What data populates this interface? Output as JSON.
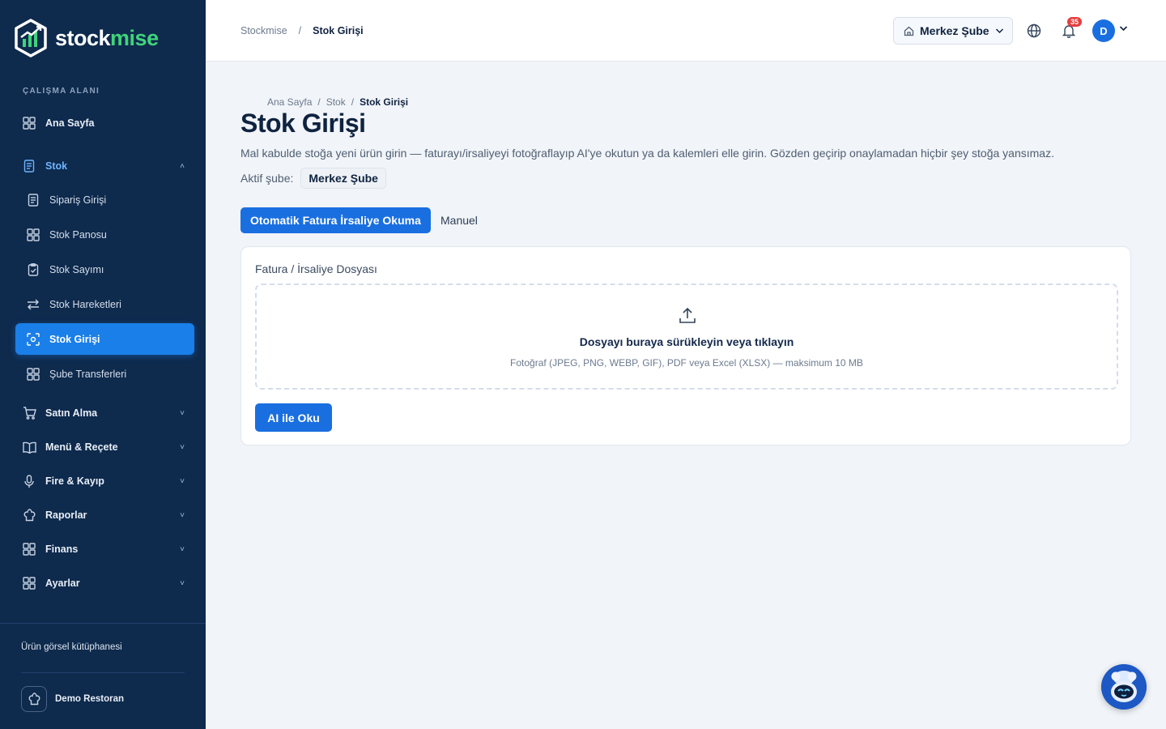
{
  "brand": {
    "part1": "stock",
    "part2": "mise"
  },
  "sidebar": {
    "section_title": "ÇALIŞMA ALANI",
    "items": [
      {
        "label": "Ana Sayfa"
      },
      {
        "label": "Stok"
      },
      {
        "label": "Sipariş Girişi"
      },
      {
        "label": "Stok Panosu"
      },
      {
        "label": "Stok Sayımı"
      },
      {
        "label": "Stok Hareketleri"
      },
      {
        "label": "Stok Girişi"
      },
      {
        "label": "Şube Transferleri"
      },
      {
        "label": "Satın Alma"
      },
      {
        "label": "Menü & Reçete"
      },
      {
        "label": "Fire & Kayıp"
      },
      {
        "label": "Raporlar"
      },
      {
        "label": "Finans"
      },
      {
        "label": "Ayarlar"
      }
    ],
    "library_link": "Ürün görsel kütüphanesi",
    "org_name": "Demo Restoran"
  },
  "topbar": {
    "crumb_root": "Stockmise",
    "crumb_sep": "/",
    "crumb_current": "Stok Girişi",
    "branch": "Merkez Şube",
    "notification_count": "35",
    "avatar_initial": "D"
  },
  "page": {
    "breadcrumb": [
      "Ana Sayfa",
      "/",
      "Stok",
      "/",
      "Stok Girişi"
    ],
    "title": "Stok Girişi",
    "description": "Mal kabulde stoğa yeni ürün girin — faturayı/irsaliyeyi fotoğraflayıp AI'ye okutun ya da kalemleri elle girin. Gözden geçirip onaylamadan hiçbir şey stoğa yansımaz.",
    "active_branch_label": "Aktif şube:",
    "active_branch": "Merkez Şube",
    "tabs": {
      "auto": "Otomatik Fatura İrsaliye Okuma",
      "manual": "Manuel"
    }
  },
  "upload": {
    "label": "Fatura / İrsaliye Dosyası",
    "drop_title": "Dosyayı buraya sürükleyin veya tıklayın",
    "drop_hint": "Fotoğraf (JPEG, PNG, WEBP, GIF), PDF veya Excel (XLSX) — maksimum 10 MB",
    "button": "AI ile Oku"
  },
  "colors": {
    "sidebar_bg": "#0e2a4d",
    "accent": "#1a6fe0",
    "brand_green": "#3fd37b",
    "badge": "#e53e3e"
  }
}
